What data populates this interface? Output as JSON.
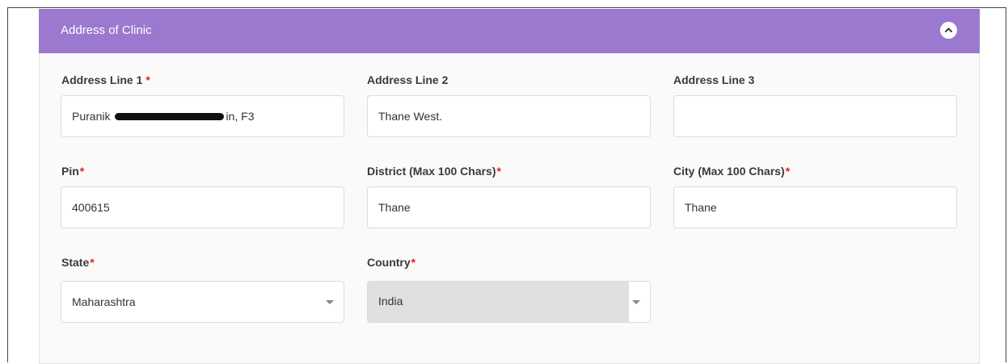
{
  "section": {
    "title": "Address of Clinic"
  },
  "fields": {
    "address_line1": {
      "label": "Address Line 1",
      "required_mark": "*",
      "value_start": "Puranik",
      "value_end": "in, F3"
    },
    "address_line2": {
      "label": "Address Line 2",
      "value": "Thane West."
    },
    "address_line3": {
      "label": "Address Line 3",
      "value": ""
    },
    "pin": {
      "label": "Pin",
      "required_mark": "*",
      "value": "400615"
    },
    "district": {
      "label": "District (Max 100 Chars)",
      "required_mark": "*",
      "value": "Thane"
    },
    "city": {
      "label": "City (Max 100 Chars)",
      "required_mark": "*",
      "value": "Thane"
    },
    "state": {
      "label": "State",
      "required_mark": "*",
      "selected": "Maharashtra"
    },
    "country": {
      "label": "Country",
      "required_mark": "*",
      "selected": "India"
    }
  },
  "colors": {
    "header": "#9b79cf",
    "required": "#e02424",
    "disabled_fill": "#e0e0e0"
  },
  "icons": {
    "collapse": "chevron-up-icon",
    "dropdown": "caret-down-icon"
  }
}
